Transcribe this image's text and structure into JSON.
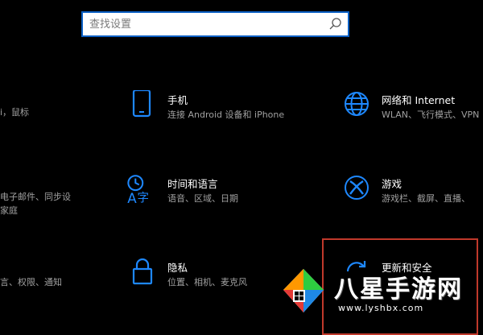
{
  "search": {
    "placeholder": "查找设置"
  },
  "edge": {
    "row1": [
      "i，鼠标"
    ],
    "row2": [
      "电子邮件、同步设",
      "家庭"
    ],
    "row3": [
      "言、权限、通知"
    ]
  },
  "tiles": {
    "phone": {
      "title": "手机",
      "desc": "连接 Android 设备和 iPhone"
    },
    "network": {
      "title": "网络和 Internet",
      "desc": "WLAN、飞行模式、VPN"
    },
    "time": {
      "title": "时间和语言",
      "desc": "语音、区域、日期"
    },
    "gaming": {
      "title": "游戏",
      "desc": "游戏栏、截屏、直播、"
    },
    "privacy": {
      "title": "隐私",
      "desc": "位置、相机、麦克风"
    },
    "update": {
      "title": "更新和安全",
      "desc": ""
    }
  },
  "watermark": {
    "name": "八星手游网",
    "url": "www.lyshbx.com"
  },
  "colors": {
    "accent": "#1e88ff",
    "highlight_border": "#c0392b",
    "background": "#000000"
  }
}
